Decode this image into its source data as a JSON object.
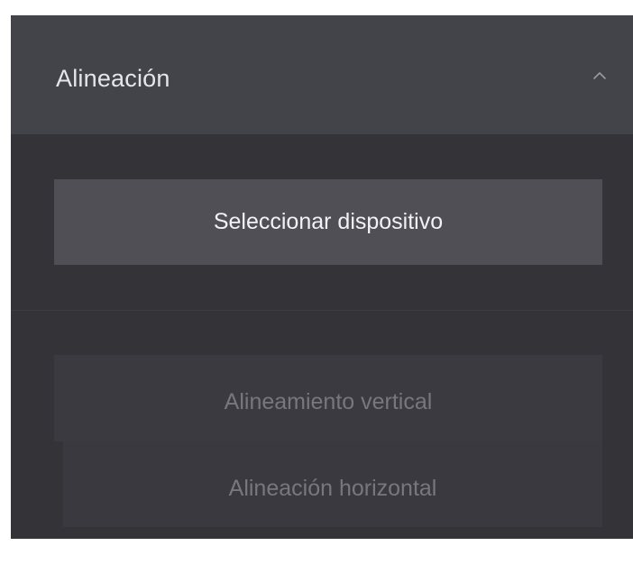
{
  "panel": {
    "title": "Alineación",
    "collapse_icon": "chevron-up-icon"
  },
  "select_device": {
    "label": "Seleccionar dispositivo"
  },
  "alignment_options": {
    "vertical": "Alineamiento vertical",
    "horizontal": "Alineación horizontal",
    "state": "disabled"
  },
  "colors": {
    "panel_bg": "#333338",
    "header_bg": "#43434a",
    "button_bg": "#4f4f55",
    "button_text": "#f2f2f4",
    "disabled_text": "#77777d"
  }
}
